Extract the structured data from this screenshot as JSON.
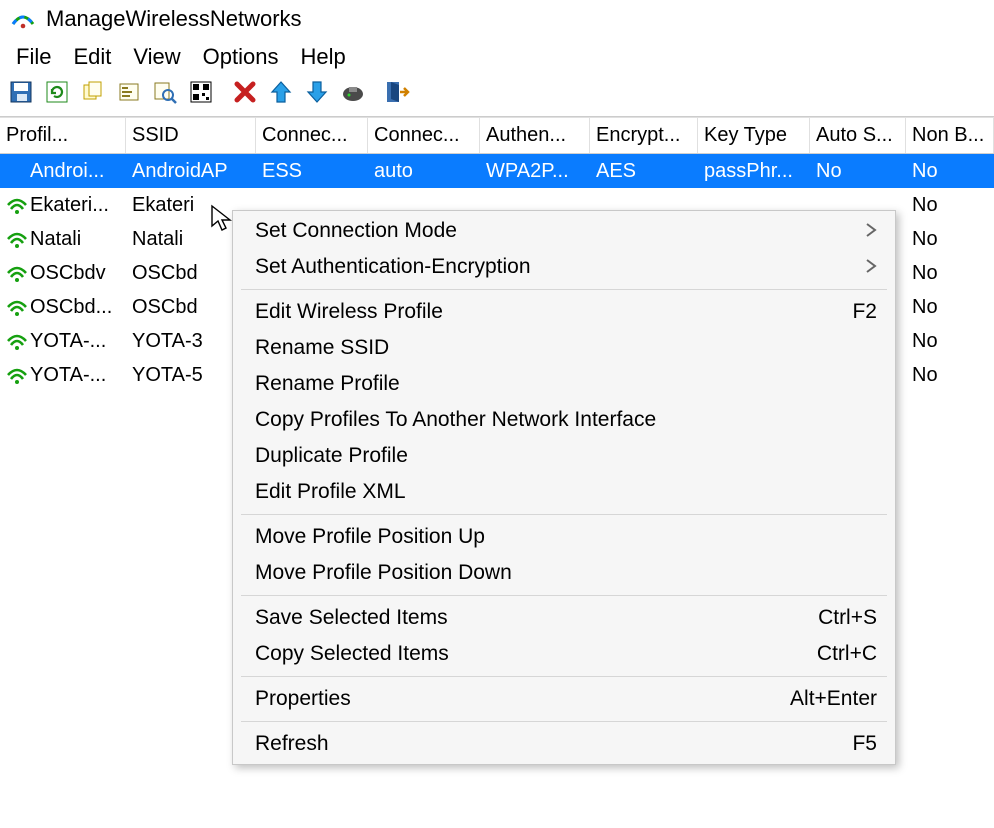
{
  "window": {
    "title": "ManageWirelessNetworks"
  },
  "menubar": [
    "File",
    "Edit",
    "View",
    "Options",
    "Help"
  ],
  "toolbar_icons": [
    "save-icon",
    "refresh-icon",
    "copy-icon",
    "properties-icon",
    "find-icon",
    "qr-icon",
    "sep",
    "delete-icon",
    "move-up-icon",
    "move-down-icon",
    "connect-icon",
    "sep",
    "exit-icon"
  ],
  "columns": [
    "Profil...",
    "SSID",
    "Connec...",
    "Connec...",
    "Authen...",
    "Encrypt...",
    "Key Type",
    "Auto S...",
    "Non B..."
  ],
  "selected_row_index": 0,
  "rows": [
    {
      "icon_color": "#0a7cff",
      "selected": true,
      "cells": [
        "Androi...",
        "AndroidAP",
        "ESS",
        "auto",
        "WPA2P...",
        "AES",
        "passPhr...",
        "No",
        "No"
      ]
    },
    {
      "icon_color": "#16a010",
      "cells": [
        "Ekateri...",
        "Ekateri",
        "",
        "",
        "",
        "",
        "",
        "",
        "No"
      ]
    },
    {
      "icon_color": "#16a010",
      "cells": [
        "Natali",
        "Natali",
        "",
        "",
        "",
        "",
        "",
        "",
        "No"
      ]
    },
    {
      "icon_color": "#16a010",
      "cells": [
        "OSCbdv",
        "OSCbd",
        "",
        "",
        "",
        "",
        "",
        "",
        "No"
      ]
    },
    {
      "icon_color": "#16a010",
      "cells": [
        "OSCbd...",
        "OSCbd",
        "",
        "",
        "",
        "",
        "",
        "",
        "No"
      ]
    },
    {
      "icon_color": "#16a010",
      "cells": [
        "YOTA-...",
        "YOTA-3",
        "",
        "",
        "",
        "",
        "",
        "",
        "No"
      ]
    },
    {
      "icon_color": "#16a010",
      "cells": [
        "YOTA-...",
        "YOTA-5",
        "",
        "",
        "",
        "",
        "",
        "",
        "No"
      ]
    }
  ],
  "context_menu": [
    {
      "label": "Set Connection Mode",
      "sub": true
    },
    {
      "label": "Set Authentication-Encryption",
      "sub": true
    },
    {
      "sep": true
    },
    {
      "label": "Edit Wireless Profile",
      "accel": "F2"
    },
    {
      "label": "Rename SSID"
    },
    {
      "label": "Rename Profile"
    },
    {
      "label": "Copy Profiles To Another Network Interface"
    },
    {
      "label": "Duplicate Profile"
    },
    {
      "label": "Edit Profile XML"
    },
    {
      "sep": true
    },
    {
      "label": "Move Profile Position Up"
    },
    {
      "label": "Move Profile Position Down"
    },
    {
      "sep": true
    },
    {
      "label": "Save Selected Items",
      "accel": "Ctrl+S"
    },
    {
      "label": "Copy Selected Items",
      "accel": "Ctrl+C"
    },
    {
      "sep": true
    },
    {
      "label": "Properties",
      "accel": "Alt+Enter"
    },
    {
      "sep": true
    },
    {
      "label": "Refresh",
      "accel": "F5"
    }
  ]
}
